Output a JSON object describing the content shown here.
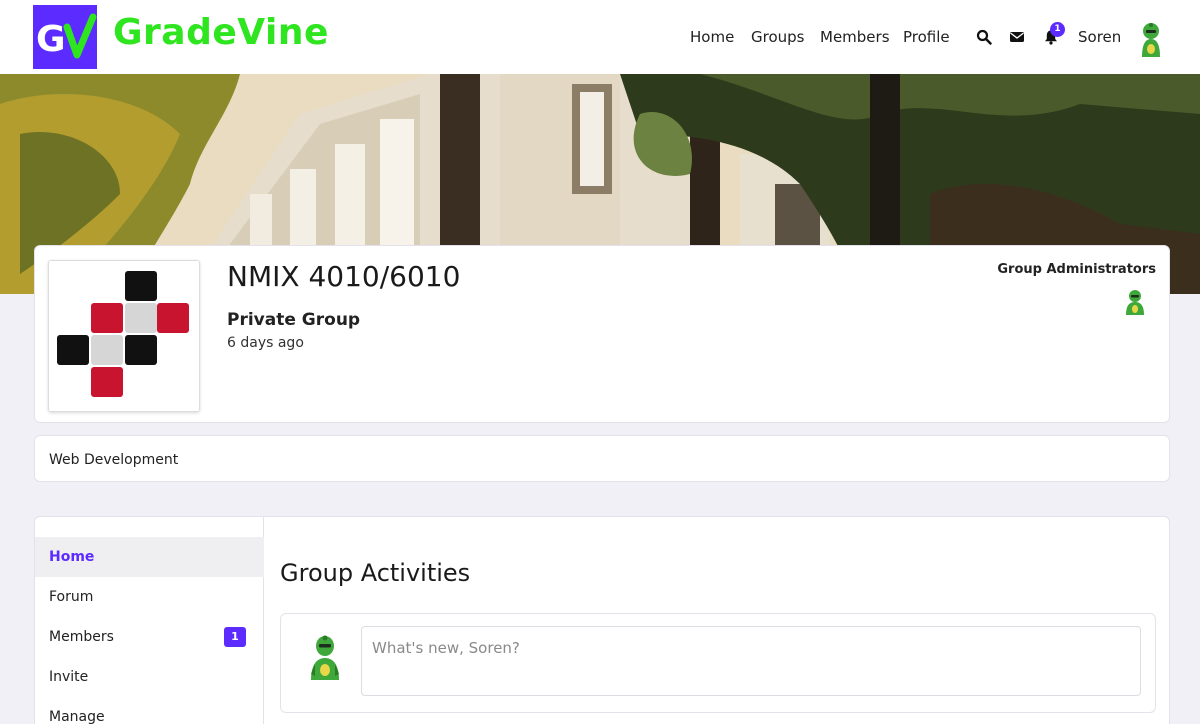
{
  "brand": {
    "name": "GradeVine",
    "logo_letters": "GV"
  },
  "nav": {
    "home": "Home",
    "groups": "Groups",
    "members": "Members",
    "profile": "Profile"
  },
  "header_icons": [
    "search-icon",
    "envelope-icon",
    "bell-icon"
  ],
  "notifications": {
    "count": "1"
  },
  "user": {
    "name": "Soren"
  },
  "group": {
    "title": "NMIX 4010/6010",
    "type": "Private Group",
    "time": "6 days ago",
    "admins_label": "Group Administrators",
    "description": "Web Development"
  },
  "side_nav": {
    "items": [
      {
        "label": "Home",
        "active": true
      },
      {
        "label": "Forum"
      },
      {
        "label": "Members",
        "badge": "1"
      },
      {
        "label": "Invite"
      },
      {
        "label": "Manage"
      }
    ]
  },
  "activities": {
    "title": "Group Activities",
    "post_placeholder": "What's new, Soren?"
  },
  "colors": {
    "accent": "#5b2bff",
    "brand_green": "#2ee51f",
    "background": "#f1f0f6"
  }
}
